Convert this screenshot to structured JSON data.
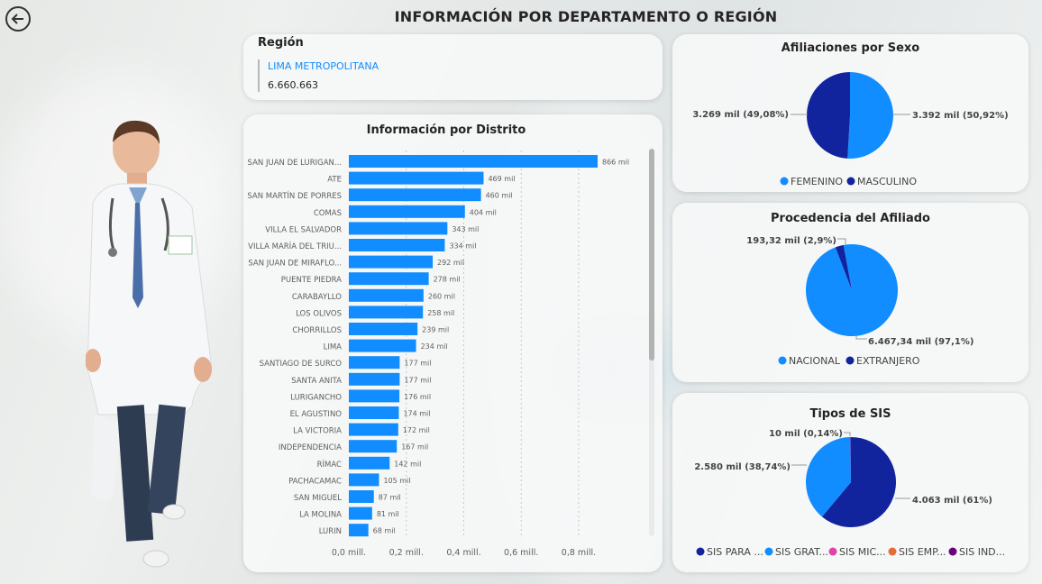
{
  "page": {
    "title": "INFORMACIÓN POR DEPARTAMENTO O REGIÓN"
  },
  "region": {
    "label": "Región",
    "name": "LIMA METROPOLITANA",
    "value": "6.660.663"
  },
  "colors": {
    "accent": "#118dff",
    "dark": "#12239e",
    "pink": "#e044a7",
    "orange": "#e66c37",
    "purple": "#6b007b"
  },
  "icons": {
    "back": "back-arrow-icon"
  },
  "districts": {
    "title": "Información por Distrito",
    "chart_data": {
      "type": "bar",
      "orientation": "horizontal",
      "categories": [
        "SAN JUAN DE LURIGAN...",
        "ATE",
        "SAN MARTÍN DE PORRES",
        "COMAS",
        "VILLA EL SALVADOR",
        "VILLA MARÍA DEL TRIU...",
        "SAN JUAN DE MIRAFLO...",
        "PUENTE PIEDRA",
        "CARABAYLLO",
        "LOS OLIVOS",
        "CHORRILLOS",
        "LIMA",
        "SANTIAGO DE SURCO",
        "SANTA ANITA",
        "LURIGANCHO",
        "EL AGUSTINO",
        "LA VICTORIA",
        "INDEPENDENCIA",
        "RÍMAC",
        "PACHACAMAC",
        "SAN MIGUEL",
        "LA MOLINA",
        "LURIN"
      ],
      "values": [
        866,
        469,
        460,
        404,
        343,
        334,
        292,
        278,
        260,
        258,
        239,
        234,
        177,
        177,
        176,
        174,
        172,
        167,
        142,
        105,
        87,
        81,
        68
      ],
      "data_labels": [
        "866 mil",
        "469 mil",
        "460 mil",
        "404 mil",
        "343 mil",
        "334 mil",
        "292 mil",
        "278 mil",
        "260 mil",
        "258 mil",
        "239 mil",
        "234 mil",
        "177 mil",
        "177 mil",
        "176 mil",
        "174 mil",
        "172 mil",
        "167 mil",
        "142 mil",
        "105 mil",
        "87 mil",
        "81 mil",
        "68 mil"
      ],
      "xticks": [
        0,
        200,
        400,
        600,
        800
      ],
      "xtick_labels": [
        "0,0 mill.",
        "0,2 mill.",
        "0,4 mill.",
        "0,6 mill.",
        "0,8 mill."
      ],
      "xlim": [
        0,
        866
      ],
      "grid": true,
      "color": "#118dff"
    }
  },
  "sex": {
    "title": "Afiliaciones por Sexo",
    "chart_data": {
      "type": "pie",
      "slices": [
        {
          "name": "FEMENINO",
          "value": 3392,
          "label": "3.392 mil (50,92%)",
          "color": "#118dff"
        },
        {
          "name": "MASCULINO",
          "value": 3269,
          "label": "3.269 mil (49,08%)",
          "color": "#12239e"
        }
      ],
      "legend_position": "bottom"
    }
  },
  "origin": {
    "title": "Procedencia del Afiliado",
    "chart_data": {
      "type": "pie",
      "slices": [
        {
          "name": "NACIONAL",
          "value": 6467.34,
          "label": "6.467,34 mil (97,1%)",
          "color": "#118dff"
        },
        {
          "name": "EXTRANJERO",
          "value": 193.32,
          "label": "193,32 mil (2,9%)",
          "color": "#12239e"
        }
      ],
      "legend_position": "bottom"
    }
  },
  "sis": {
    "title": "Tipos de SIS",
    "chart_data": {
      "type": "pie",
      "slices": [
        {
          "name": "SIS PARA ...",
          "value": 4063,
          "label": "4.063 mil (61%)",
          "color": "#12239e"
        },
        {
          "name": "SIS GRAT...",
          "value": 2580,
          "label": "2.580 mil (38,74%)",
          "color": "#118dff"
        },
        {
          "name": "SIS MIC...",
          "value": 0,
          "label": "",
          "color": "#e044a7"
        },
        {
          "name": "SIS EMP...",
          "value": 0,
          "label": "",
          "color": "#e66c37"
        },
        {
          "name": "SIS IND...",
          "value": 10,
          "label": "10 mil (0,14%)",
          "color": "#6b007b"
        }
      ],
      "legend_position": "bottom"
    }
  }
}
